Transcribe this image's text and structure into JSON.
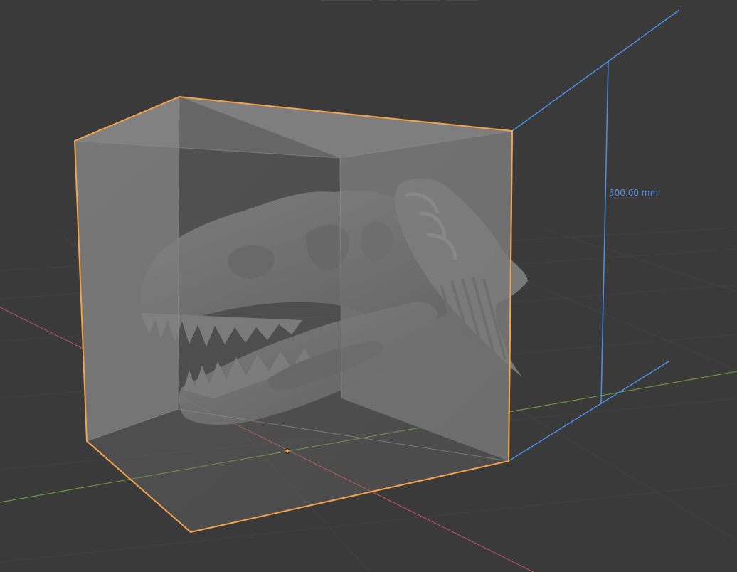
{
  "viewport": {
    "background_color": "#3a3a3a",
    "grid_color": "#434343",
    "axis_x_color": "#c0545a",
    "axis_y_color": "#6f9a3e"
  },
  "selection": {
    "outline_color": "#f4a24b",
    "origin_color": "#f4a24b"
  },
  "measurement": {
    "label": "300.00 mm",
    "color": "#4f8ee6"
  },
  "header_tool_buttons": [
    {
      "icon": "viewport-shading-button"
    },
    {
      "icon": "viewport-shading-button"
    },
    {
      "icon": "viewport-shading-button"
    },
    {
      "icon": "viewport-shading-button"
    }
  ]
}
